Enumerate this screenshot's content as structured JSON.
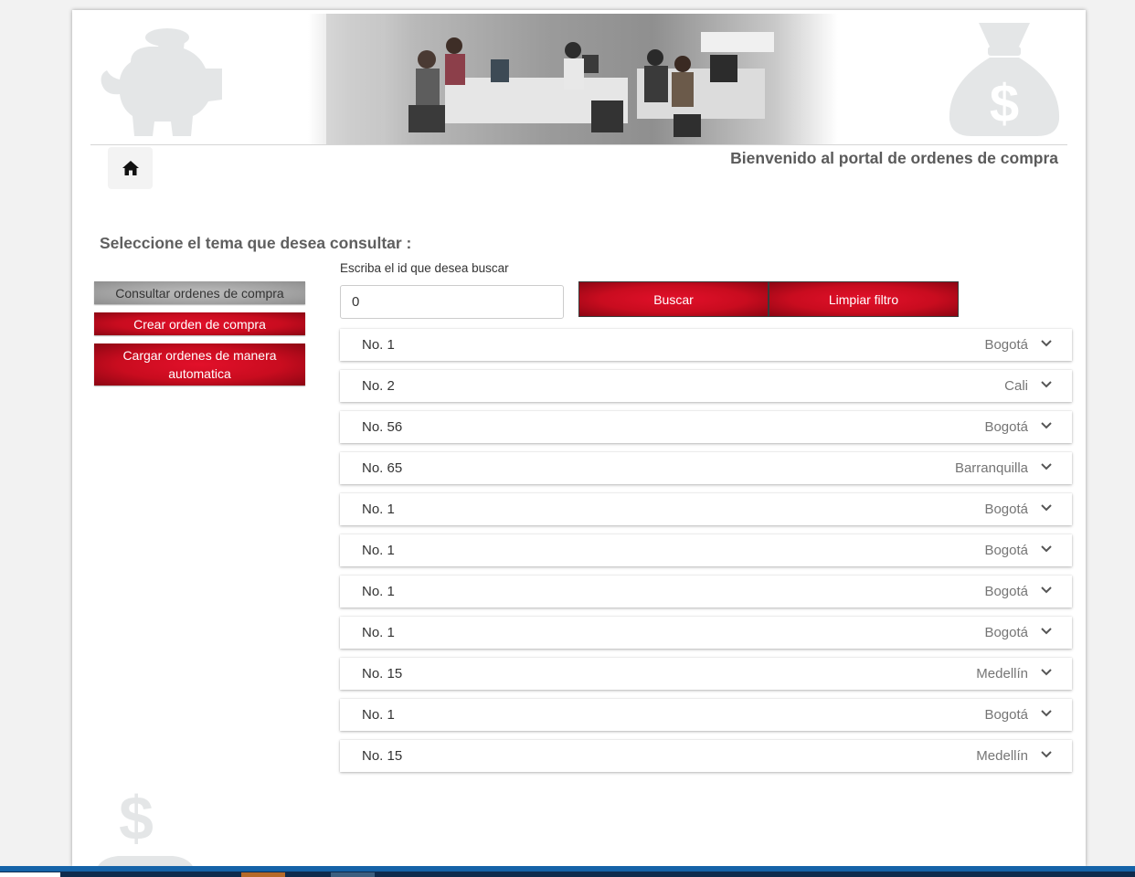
{
  "header": {
    "welcome": "Bienvenido al portal de ordenes de compra"
  },
  "main": {
    "section_title": "Seleccione el tema que desea consultar :"
  },
  "sidebar": {
    "items": [
      {
        "label": "Consultar ordenes de compra",
        "active": true
      },
      {
        "label": "Crear orden de compra",
        "active": false
      },
      {
        "label": "Cargar ordenes de manera automatica",
        "active": false
      }
    ]
  },
  "search": {
    "label": "Escriba el id que desea buscar",
    "value": "0",
    "search_button": "Buscar",
    "clear_button": "Limpiar filtro"
  },
  "orders": [
    {
      "number": "No. 1",
      "city": "Bogotá"
    },
    {
      "number": "No. 2",
      "city": "Cali"
    },
    {
      "number": "No. 56",
      "city": "Bogotá"
    },
    {
      "number": "No. 65",
      "city": "Barranquilla"
    },
    {
      "number": "No. 1",
      "city": "Bogotá"
    },
    {
      "number": "No. 1",
      "city": "Bogotá"
    },
    {
      "number": "No. 1",
      "city": "Bogotá"
    },
    {
      "number": "No. 1",
      "city": "Bogotá"
    },
    {
      "number": "No. 15",
      "city": "Medellín"
    },
    {
      "number": "No. 1",
      "city": "Bogotá"
    },
    {
      "number": "No. 15",
      "city": "Medellín"
    }
  ],
  "icons": {
    "home": "home-icon",
    "expand": "chevron-down-icon",
    "banner_left": "piggy-bank-icon",
    "banner_right": "money-bag-icon",
    "bottom_decor": "money-bag-icon"
  },
  "colors": {
    "accent": "#c90c1f",
    "inactive_button": "#a3a3a3",
    "decor": "#e4e6e7",
    "taskbar": "#1563a8"
  }
}
